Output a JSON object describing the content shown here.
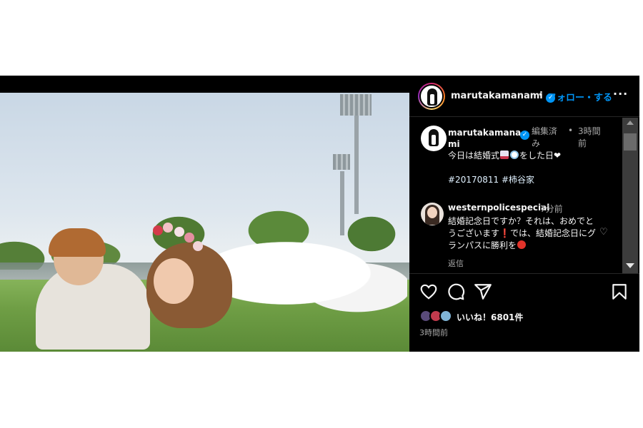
{
  "post": {
    "username": "marutakamanami",
    "follow_label": "フォロー・する",
    "more_label": "···",
    "dot": "•"
  },
  "caption": {
    "username": "marutakamanami",
    "edited": "編集済み",
    "dot": "•",
    "time": "3時間前",
    "text_pre": "今日は結婚式",
    "text_post": "をした日",
    "hashtags": [
      "#20170811",
      "#柿谷家"
    ]
  },
  "comment": {
    "username": "westernpolicespecial",
    "time": "7分前",
    "text": "結婚記念日ですか？それは、おめでとうございます❗では、結婚記念日にグランパスに勝利を",
    "reply_label": "返信"
  },
  "actions": {
    "likes_label": "いいね！6801件",
    "time": "3時間前"
  },
  "colors": {
    "background": "#000000",
    "link_blue": "#0095f6",
    "muted": "#a8a8a8"
  },
  "icons": {
    "verified": "verified-badge-icon",
    "heart": "heart-icon",
    "comment": "comment-icon",
    "share": "share-icon",
    "save": "bookmark-icon",
    "more": "more-options-icon"
  }
}
